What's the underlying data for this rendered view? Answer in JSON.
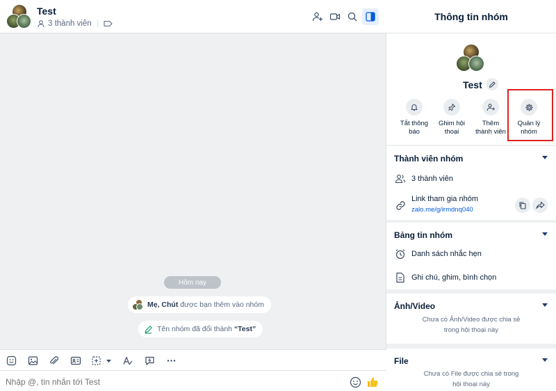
{
  "chat": {
    "title": "Test",
    "member_count": "3 thành viên",
    "date_label": "Hôm nay",
    "notice_added_names": "Mẹ, Chút",
    "notice_added_suffix": "được bạn thêm vào nhóm",
    "notice_rename_prefix": "Tên nhóm đã đổi thành",
    "notice_rename_value": "“Test”",
    "composer_placeholder": "Nhập @, tin nhắn tới Test",
    "header_icons": [
      "add-member-icon",
      "video-call-icon",
      "search-icon",
      "toggle-panel-icon"
    ],
    "toolbar_icons": [
      "sticker-icon",
      "image-icon",
      "attachment-icon",
      "contact-card-icon",
      "screenshot-icon",
      "text-format-icon",
      "quick-message-icon",
      "more-icon"
    ]
  },
  "panel": {
    "title": "Thông tin nhóm",
    "group_name": "Test",
    "actions": [
      {
        "label_1": "Tắt thông",
        "label_2": "báo",
        "icon": "bell-icon"
      },
      {
        "label_1": "Ghim hội",
        "label_2": "thoại",
        "icon": "pin-icon"
      },
      {
        "label_1": "Thêm",
        "label_2": "thành viên",
        "icon": "add-member-icon"
      },
      {
        "label_1": "Quản lý",
        "label_2": "nhóm",
        "icon": "gear-icon"
      }
    ],
    "members": {
      "title": "Thành viên nhóm",
      "count": "3 thành viên",
      "link_label": "Link tham gia nhóm",
      "link_url": "zalo.me/g/irmdnq040"
    },
    "board": {
      "title": "Bảng tin nhóm",
      "reminders": "Danh sách nhắc hẹn",
      "notes": "Ghi chú, ghim, bình chọn"
    },
    "media": {
      "title": "Ảnh/Video",
      "empty_1": "Chưa có Ảnh/Video được chia sẻ",
      "empty_2": "trong hội thoại này"
    },
    "files": {
      "title": "File",
      "empty_1": "Chưa có File được chia sẻ trong",
      "empty_2": "hội thoại này"
    }
  },
  "colors": {
    "accent": "#005ae0",
    "highlight": "#e0201f",
    "background": "#eef0f1"
  }
}
